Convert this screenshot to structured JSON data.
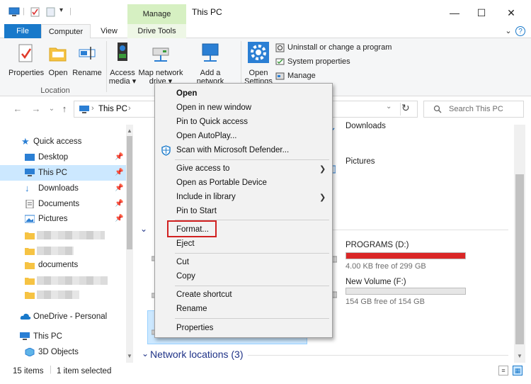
{
  "window": {
    "title": "This PC",
    "context_tab": "Manage",
    "minimize": "—",
    "maximize": "☐",
    "close": "✕"
  },
  "ribbon_tabs": {
    "file": "File",
    "computer": "Computer",
    "view": "View",
    "drive_tools": "Drive Tools"
  },
  "ribbon": {
    "location_group": {
      "label": "Location",
      "properties": "Properties",
      "open": "Open",
      "rename": "Rename"
    },
    "network_group": {
      "access_media": "Access media ▾",
      "map_network_drive": "Map network drive ▾",
      "add_network_location": "Add a network location"
    },
    "system_group": {
      "open_settings": "Open Settings",
      "uninstall": "Uninstall or change a program",
      "system_properties": "System properties",
      "manage": "Manage"
    }
  },
  "address": {
    "path": "This PC",
    "search_placeholder": "Search This PC"
  },
  "nav": {
    "quick_access": "Quick access",
    "desktop": "Desktop",
    "this_pc_pinned": "This PC",
    "downloads": "Downloads",
    "documents": "Documents",
    "pictures": "Pictures",
    "documents_folder": "documents",
    "onedrive": "OneDrive - Personal",
    "this_pc": "This PC",
    "objects3d": "3D Objects"
  },
  "content": {
    "downloads_folder": "Downloads",
    "pictures_folder": "Pictures",
    "drives": [
      {
        "name": "PROGRAMS (D:)",
        "free": "4.00 KB free of 299 GB",
        "used_fraction": 1.0,
        "bar_color": "#da2626"
      },
      {
        "name": "New Volume (F:)",
        "free": "154 GB free of 154 GB",
        "used_fraction": 0.0,
        "bar_color": "#26a0da"
      }
    ],
    "network_locations": "Network locations (3)"
  },
  "status": {
    "items": "15 items",
    "selected": "1 item selected"
  },
  "context_menu": {
    "open": "Open",
    "open_new_window": "Open in new window",
    "pin_quick_access": "Pin to Quick access",
    "open_autoplay": "Open AutoPlay...",
    "scan_defender": "Scan with Microsoft Defender...",
    "give_access": "Give access to",
    "open_portable": "Open as Portable Device",
    "include_library": "Include in library",
    "pin_start": "Pin to Start",
    "format": "Format...",
    "eject": "Eject",
    "cut": "Cut",
    "copy": "Copy",
    "create_shortcut": "Create shortcut",
    "rename": "Rename",
    "properties": "Properties"
  },
  "colors": {
    "accent": "#1979ca",
    "highlight_box": "#d12121",
    "drive_full": "#da2626"
  }
}
